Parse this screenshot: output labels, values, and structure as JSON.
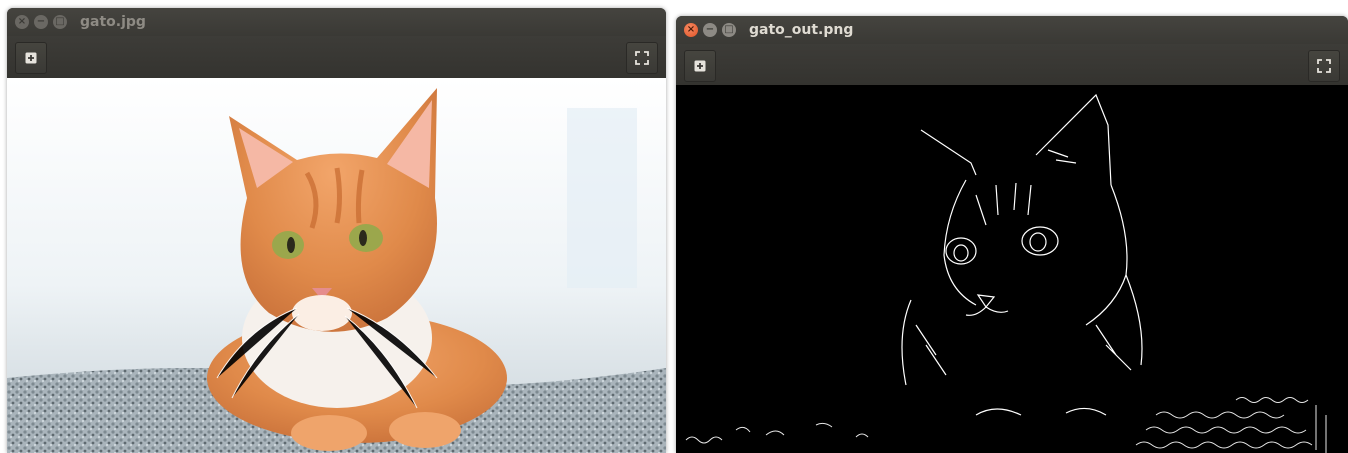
{
  "windows": [
    {
      "title": "gato.jpg",
      "state": "inactive",
      "image": "orange tabby cat lying on grey carpet"
    },
    {
      "title": "gato_out.png",
      "state": "active",
      "image": "edge-detected outline of the cat, white lines on black"
    }
  ],
  "icons": {
    "close": "close-icon",
    "minimize": "minimize-icon",
    "maximize": "maximize-icon",
    "zoom_in": "zoom-in-icon",
    "fullscreen": "fullscreen-icon"
  },
  "colors": {
    "titlebar": "#3b3a36",
    "title_active": "#dfdbd2",
    "title_inactive": "#8e8b84",
    "close_active": "#e05326",
    "cat_orange": "#e08a4a",
    "edges": "#ffffff"
  }
}
